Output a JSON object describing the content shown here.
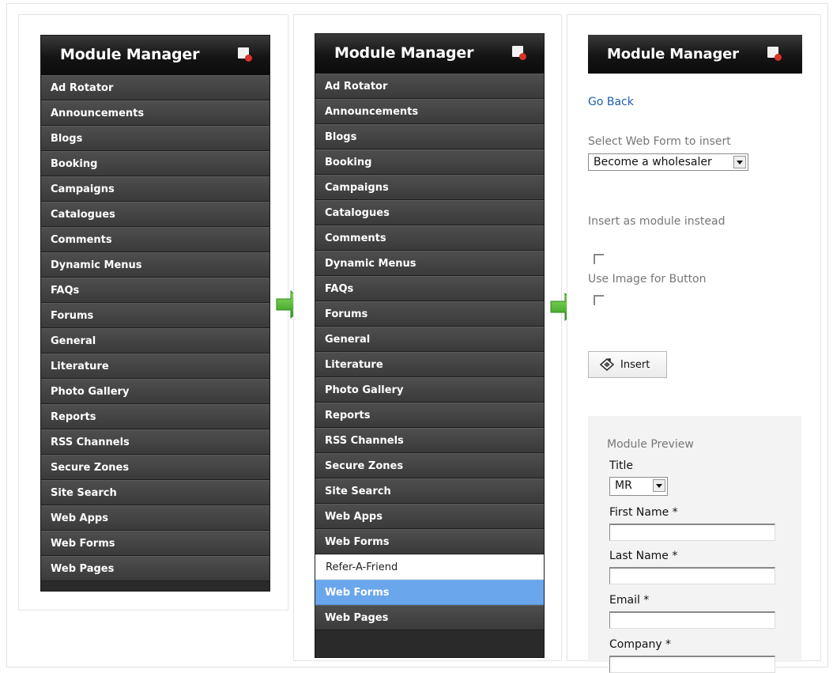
{
  "module_manager": {
    "title": "Module Manager",
    "icon": "window-close-icon",
    "items": [
      "Ad Rotator",
      "Announcements",
      "Blogs",
      "Booking",
      "Campaigns",
      "Catalogues",
      "Comments",
      "Dynamic Menus",
      "FAQs",
      "Forums",
      "General",
      "Literature",
      "Photo Gallery",
      "Reports",
      "RSS Channels",
      "Secure Zones",
      "Site Search",
      "Web Apps",
      "Web Forms",
      "Web Pages"
    ]
  },
  "panel2_extra": {
    "sub_item": "Refer-A-Friend",
    "selected_item": "Web Forms",
    "last_item": "Web Pages"
  },
  "insert_panel": {
    "go_back": "Go Back",
    "select_label": "Select Web Form to insert",
    "select_value": "Become a wholesaler",
    "insert_as_module_label": "Insert as module instead",
    "insert_as_module_checked": false,
    "use_image_label": "Use Image for Button",
    "use_image_checked": false,
    "insert_button": "Insert",
    "insert_icon": "diamond-tag-icon"
  },
  "preview": {
    "heading": "Module Preview",
    "title_label": "Title",
    "title_value": "MR",
    "first_name_label": "First Name *",
    "last_name_label": "Last Name *",
    "email_label": "Email *",
    "company_label": "Company *"
  },
  "colors": {
    "selected": "#69a6ec",
    "link": "#1b5fa8",
    "arrow": "#3fae2a"
  }
}
